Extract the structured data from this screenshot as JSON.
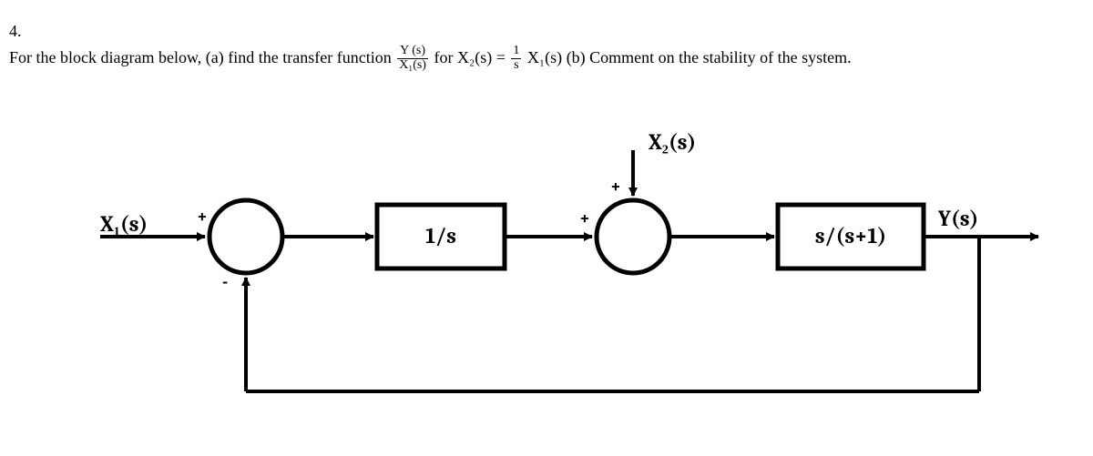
{
  "question": {
    "number": "4.",
    "text_a": "For the block diagram below, (a) find the transfer function ",
    "tf_num": "Y (s)",
    "tf_den": "X₁(s)",
    "text_b": " for ",
    "x2_lhs": "X₂(s)",
    "eq": " = ",
    "frac2_num": "1",
    "frac2_den": "s",
    "x1_label": "X₁(s)",
    "text_c": " (b) Comment on the stability of the system."
  },
  "diagram": {
    "input_label": "X₁(s)",
    "disturbance_label": "X₂(s)",
    "output_label": "Y(s)",
    "block1": "1/s",
    "block2": "s/(s+1)",
    "sum1_plus": "+",
    "sum1_minus": "-",
    "sum2_plus_left": "+",
    "sum2_plus_top": "+"
  },
  "chart_data": {
    "type": "diagram",
    "description": "Control-system block diagram with negative feedback",
    "nodes": [
      {
        "id": "in",
        "type": "input",
        "label": "X₁(s)"
      },
      {
        "id": "s1",
        "type": "summer",
        "signs": [
          "+",
          "-"
        ]
      },
      {
        "id": "g1",
        "type": "block",
        "tf": "1/s"
      },
      {
        "id": "s2",
        "type": "summer",
        "signs": [
          "+",
          "+"
        ]
      },
      {
        "id": "d",
        "type": "input",
        "label": "X₂(s)"
      },
      {
        "id": "g2",
        "type": "block",
        "tf": "s/(s+1)"
      },
      {
        "id": "out",
        "type": "output",
        "label": "Y(s)"
      }
    ],
    "edges": [
      {
        "from": "in",
        "to": "s1"
      },
      {
        "from": "s1",
        "to": "g1"
      },
      {
        "from": "g1",
        "to": "s2"
      },
      {
        "from": "d",
        "to": "s2"
      },
      {
        "from": "s2",
        "to": "g2"
      },
      {
        "from": "g2",
        "to": "out"
      },
      {
        "from": "out",
        "to": "s1",
        "feedback": true,
        "sign": "-"
      }
    ],
    "given_relation": "X₂(s) = (1/s) X₁(s)"
  }
}
